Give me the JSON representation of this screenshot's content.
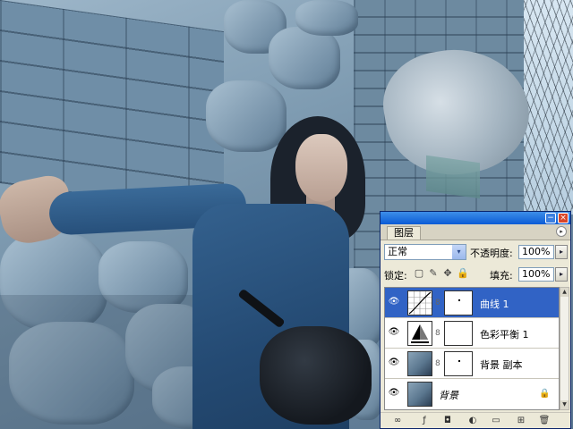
{
  "window": {
    "min_symbol": "−",
    "close_symbol": "×"
  },
  "panel": {
    "tab_label": "图层",
    "menu_arrow": "▸",
    "blend_mode": "正常",
    "opacity_label": "不透明度:",
    "opacity_value": "100%",
    "lock_label": "锁定:",
    "fill_label": "填充:",
    "fill_value": "100%"
  },
  "layers": [
    {
      "name": "曲线 1",
      "active": true,
      "eye": "👁",
      "chain": "8"
    },
    {
      "name": "色彩平衡 1",
      "active": false,
      "eye": "👁",
      "chain": "8"
    },
    {
      "name": "背景 副本",
      "active": false,
      "eye": "👁",
      "chain": "8"
    },
    {
      "name": "背景",
      "active": false,
      "eye": "👁",
      "locked": true
    }
  ],
  "icons": {
    "dropdown": "▾",
    "slider": "▸",
    "lock_transparency": "▢",
    "lock_paint": "✎",
    "lock_move": "✥",
    "lock_all": "🔒",
    "scroll_up": "▲",
    "scroll_down": "▼",
    "bottom": [
      "∞",
      "ƒ",
      "◘",
      "◐",
      "▭",
      "⊞",
      "🗑"
    ]
  }
}
